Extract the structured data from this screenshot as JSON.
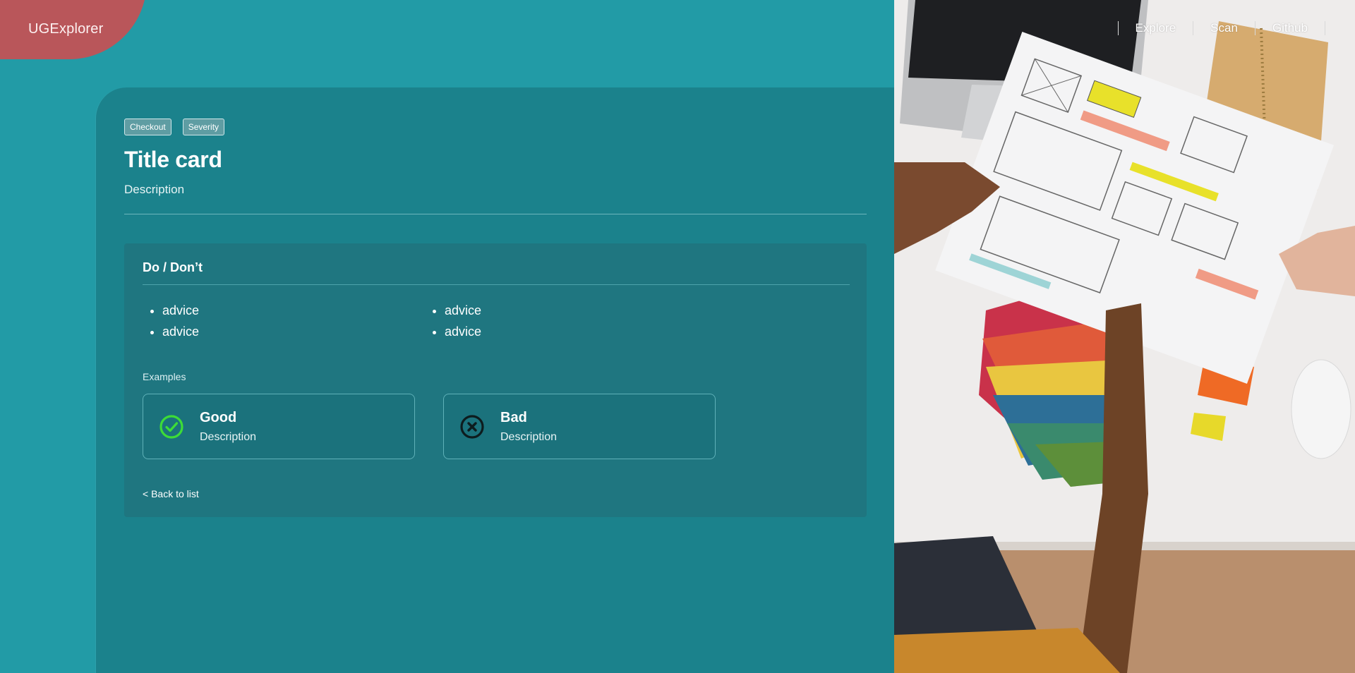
{
  "app": {
    "logo": "UGExplorer"
  },
  "nav": {
    "items": [
      "Explore",
      "Scan",
      "Github"
    ]
  },
  "card": {
    "tags": [
      "Checkout",
      "Severity"
    ],
    "title": "Title card",
    "description": "Description"
  },
  "dodont": {
    "title": "Do / Don’t",
    "do_advice": [
      "advice",
      "advice"
    ],
    "dont_advice": [
      "advice",
      "advice"
    ],
    "examples_label": "Examples",
    "good": {
      "title": "Good",
      "description": "Description",
      "icon": "check-circle-icon",
      "color": "#3ddc37"
    },
    "bad": {
      "title": "Bad",
      "description": "Description",
      "icon": "x-circle-icon",
      "color": "#0d1c1e"
    },
    "back_link": "< Back to list"
  },
  "colors": {
    "background": "#229ba6",
    "panel": "#1b828c",
    "logo_blob": "#b9565a"
  }
}
